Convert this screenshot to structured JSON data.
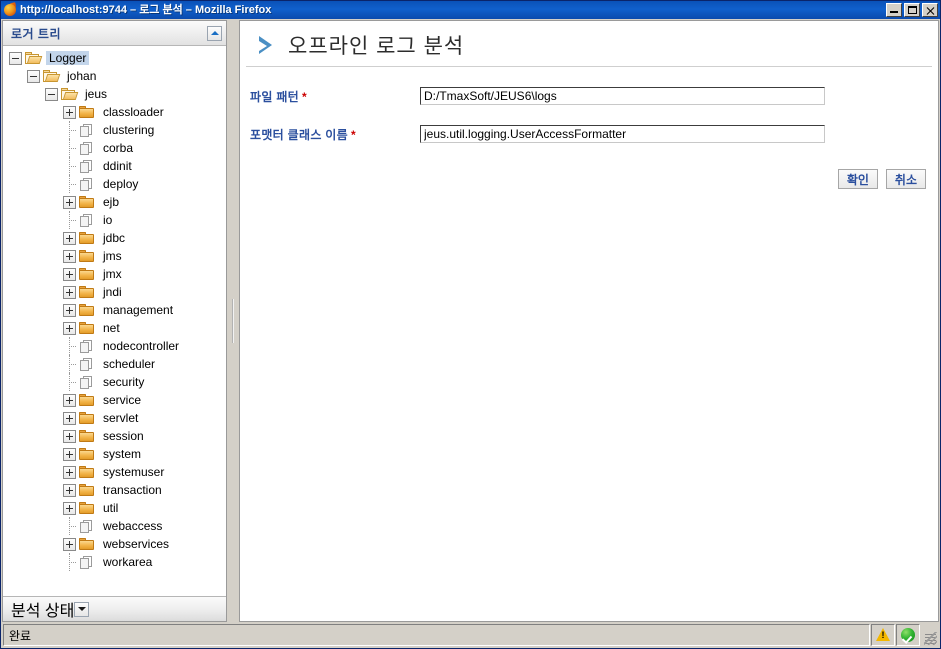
{
  "window": {
    "title": "http://localhost:9744 – 로그 분석 – Mozilla Firefox",
    "icon": "firefox-icon",
    "controls": {
      "minimize": "minimize-button",
      "maximize": "maximize-button",
      "close": "close-button"
    }
  },
  "left_panel": {
    "header_title": "로거 트리",
    "collapse_button": "collapse-up-button",
    "footer_title": "분석 상태",
    "footer_button": "expand-down-button",
    "tree": [
      {
        "label": "Logger",
        "depth": 0,
        "icon": "folder-open-icon",
        "toggle": "minus",
        "selected": true
      },
      {
        "label": "johan",
        "depth": 1,
        "icon": "folder-open-icon",
        "toggle": "minus",
        "selected": false
      },
      {
        "label": "jeus",
        "depth": 2,
        "icon": "folder-open-icon",
        "toggle": "minus",
        "selected": false
      },
      {
        "label": "classloader",
        "depth": 3,
        "icon": "folder-icon",
        "toggle": "plus",
        "selected": false
      },
      {
        "label": "clustering",
        "depth": 3,
        "icon": "document-icon",
        "toggle": "none",
        "selected": false
      },
      {
        "label": "corba",
        "depth": 3,
        "icon": "document-icon",
        "toggle": "none",
        "selected": false
      },
      {
        "label": "ddinit",
        "depth": 3,
        "icon": "document-icon",
        "toggle": "none",
        "selected": false
      },
      {
        "label": "deploy",
        "depth": 3,
        "icon": "document-icon",
        "toggle": "none",
        "selected": false
      },
      {
        "label": "ejb",
        "depth": 3,
        "icon": "folder-icon",
        "toggle": "plus",
        "selected": false
      },
      {
        "label": "io",
        "depth": 3,
        "icon": "document-icon",
        "toggle": "none",
        "selected": false
      },
      {
        "label": "jdbc",
        "depth": 3,
        "icon": "folder-icon",
        "toggle": "plus",
        "selected": false
      },
      {
        "label": "jms",
        "depth": 3,
        "icon": "folder-icon",
        "toggle": "plus",
        "selected": false
      },
      {
        "label": "jmx",
        "depth": 3,
        "icon": "folder-icon",
        "toggle": "plus",
        "selected": false
      },
      {
        "label": "jndi",
        "depth": 3,
        "icon": "folder-icon",
        "toggle": "plus",
        "selected": false
      },
      {
        "label": "management",
        "depth": 3,
        "icon": "folder-icon",
        "toggle": "plus",
        "selected": false
      },
      {
        "label": "net",
        "depth": 3,
        "icon": "folder-icon",
        "toggle": "plus",
        "selected": false
      },
      {
        "label": "nodecontroller",
        "depth": 3,
        "icon": "document-icon",
        "toggle": "none",
        "selected": false
      },
      {
        "label": "scheduler",
        "depth": 3,
        "icon": "document-icon",
        "toggle": "none",
        "selected": false
      },
      {
        "label": "security",
        "depth": 3,
        "icon": "document-icon",
        "toggle": "none",
        "selected": false
      },
      {
        "label": "service",
        "depth": 3,
        "icon": "folder-icon",
        "toggle": "plus",
        "selected": false
      },
      {
        "label": "servlet",
        "depth": 3,
        "icon": "folder-icon",
        "toggle": "plus",
        "selected": false
      },
      {
        "label": "session",
        "depth": 3,
        "icon": "folder-icon",
        "toggle": "plus",
        "selected": false
      },
      {
        "label": "system",
        "depth": 3,
        "icon": "folder-icon",
        "toggle": "plus",
        "selected": false
      },
      {
        "label": "systemuser",
        "depth": 3,
        "icon": "folder-icon",
        "toggle": "plus",
        "selected": false
      },
      {
        "label": "transaction",
        "depth": 3,
        "icon": "folder-icon",
        "toggle": "plus",
        "selected": false
      },
      {
        "label": "util",
        "depth": 3,
        "icon": "folder-icon",
        "toggle": "plus",
        "selected": false
      },
      {
        "label": "webaccess",
        "depth": 3,
        "icon": "document-icon",
        "toggle": "none",
        "selected": false
      },
      {
        "label": "webservices",
        "depth": 3,
        "icon": "folder-icon",
        "toggle": "plus",
        "selected": false
      },
      {
        "label": "workarea",
        "depth": 3,
        "icon": "document-icon",
        "toggle": "none",
        "selected": false
      }
    ]
  },
  "content": {
    "title": "오프라인 로그 분석",
    "title_icon": "chevron-right-icon",
    "fields": [
      {
        "label": "파일 패턴",
        "required": "*",
        "value": "D:/TmaxSoft/JEUS6\\logs",
        "placeholder": ""
      },
      {
        "label": "포맷터 클래스 이름",
        "required": "*",
        "value": "jeus.util.logging.UserAccessFormatter",
        "placeholder": ""
      }
    ],
    "buttons": {
      "confirm": "확인",
      "cancel": "취소"
    }
  },
  "statusbar": {
    "message": "완료",
    "warning_icon": "warning-triangle-icon",
    "ok_icon": "green-check-icon",
    "resize_grip": "resize-grip-icon"
  },
  "colors": {
    "titlebar": "#0a51b8",
    "label_blue": "#2b4f9e",
    "required_red": "#cc0000",
    "panel_header_blue": "#2a4b8d",
    "chevron_blue": "#4a8fc4",
    "selection": "#c3d5ea"
  }
}
